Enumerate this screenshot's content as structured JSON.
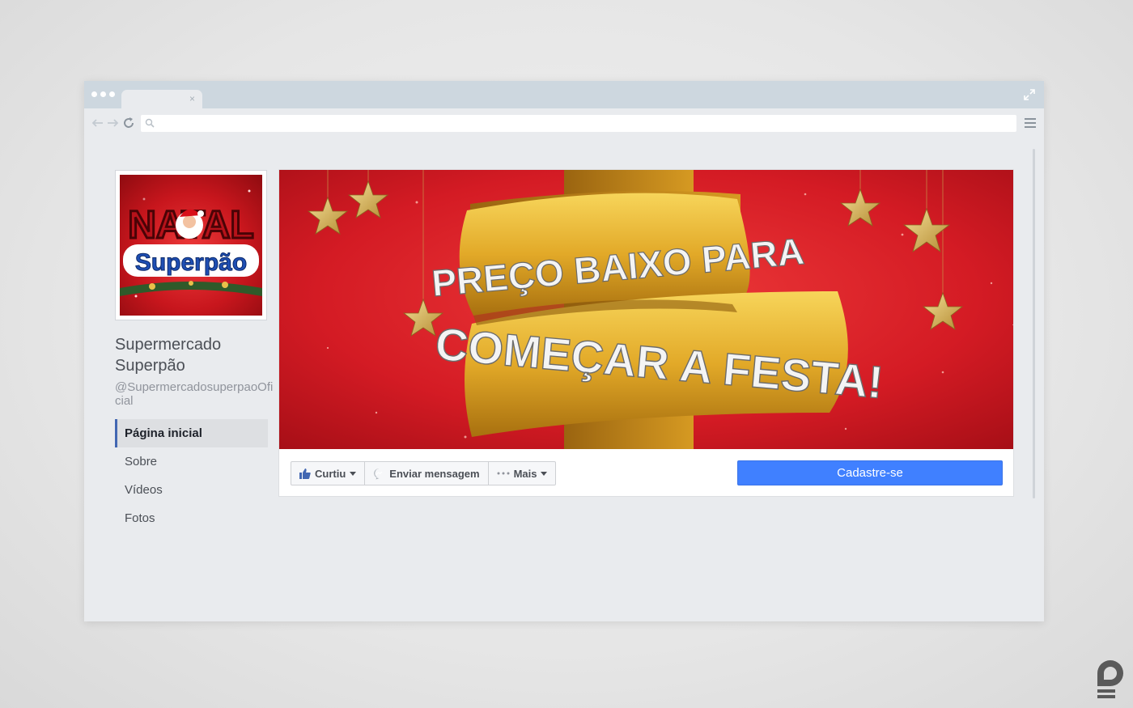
{
  "browser": {
    "tab_close": "×",
    "url_value": "",
    "url_placeholder": ""
  },
  "profile": {
    "name": "Supermercado Superpão",
    "handle": "@SupermercadosuperpaoOficial",
    "avatar_text_top": "NATAL",
    "avatar_text_bottom": "Superpão"
  },
  "sidebar": {
    "items": [
      {
        "label": "Página inicial",
        "active": true
      },
      {
        "label": "Sobre"
      },
      {
        "label": "Vídeos"
      },
      {
        "label": "Fotos"
      }
    ]
  },
  "cover": {
    "line1": "PREÇO BAIXO PARA",
    "line2": "COMEÇAR A FESTA!",
    "watermark": "pulsar"
  },
  "actions": {
    "like_label": "Curtiu",
    "message_label": "Enviar mensagem",
    "more_label": "Mais",
    "signup_label": "Cadastre-se"
  },
  "colors": {
    "facebook_blue": "#4080ff",
    "cover_red": "#d41b24",
    "ribbon_gold": "#e2a928",
    "chrome": "#cdd7df"
  }
}
